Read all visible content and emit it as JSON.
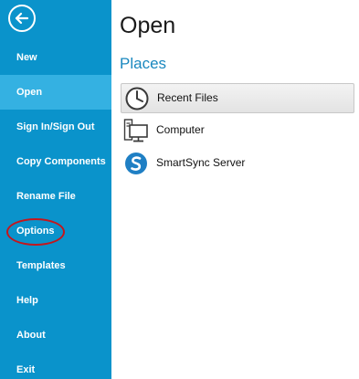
{
  "sidebar": {
    "back_icon": "back-arrow-circle-icon",
    "items": [
      {
        "label": "New"
      },
      {
        "label": "Open",
        "selected": true
      },
      {
        "label": "Sign In/Sign Out"
      },
      {
        "label": "Copy Components"
      },
      {
        "label": "Rename File"
      },
      {
        "label": "Options",
        "highlighted": true
      },
      {
        "label": "Templates"
      },
      {
        "label": "Help"
      },
      {
        "label": "About"
      },
      {
        "label": "Exit"
      }
    ]
  },
  "main": {
    "title": "Open",
    "section_title": "Places",
    "places": [
      {
        "label": "Recent Files",
        "icon": "clock-icon",
        "selected": true
      },
      {
        "label": "Computer",
        "icon": "computer-icon"
      },
      {
        "label": "SmartSync Server",
        "icon": "smartsync-logo-icon"
      }
    ]
  },
  "colors": {
    "sidebar_bg": "#0a93cb",
    "sidebar_selected": "#34b1e2",
    "accent_text": "#1a88bf",
    "annotation_circle": "#c4161c"
  }
}
